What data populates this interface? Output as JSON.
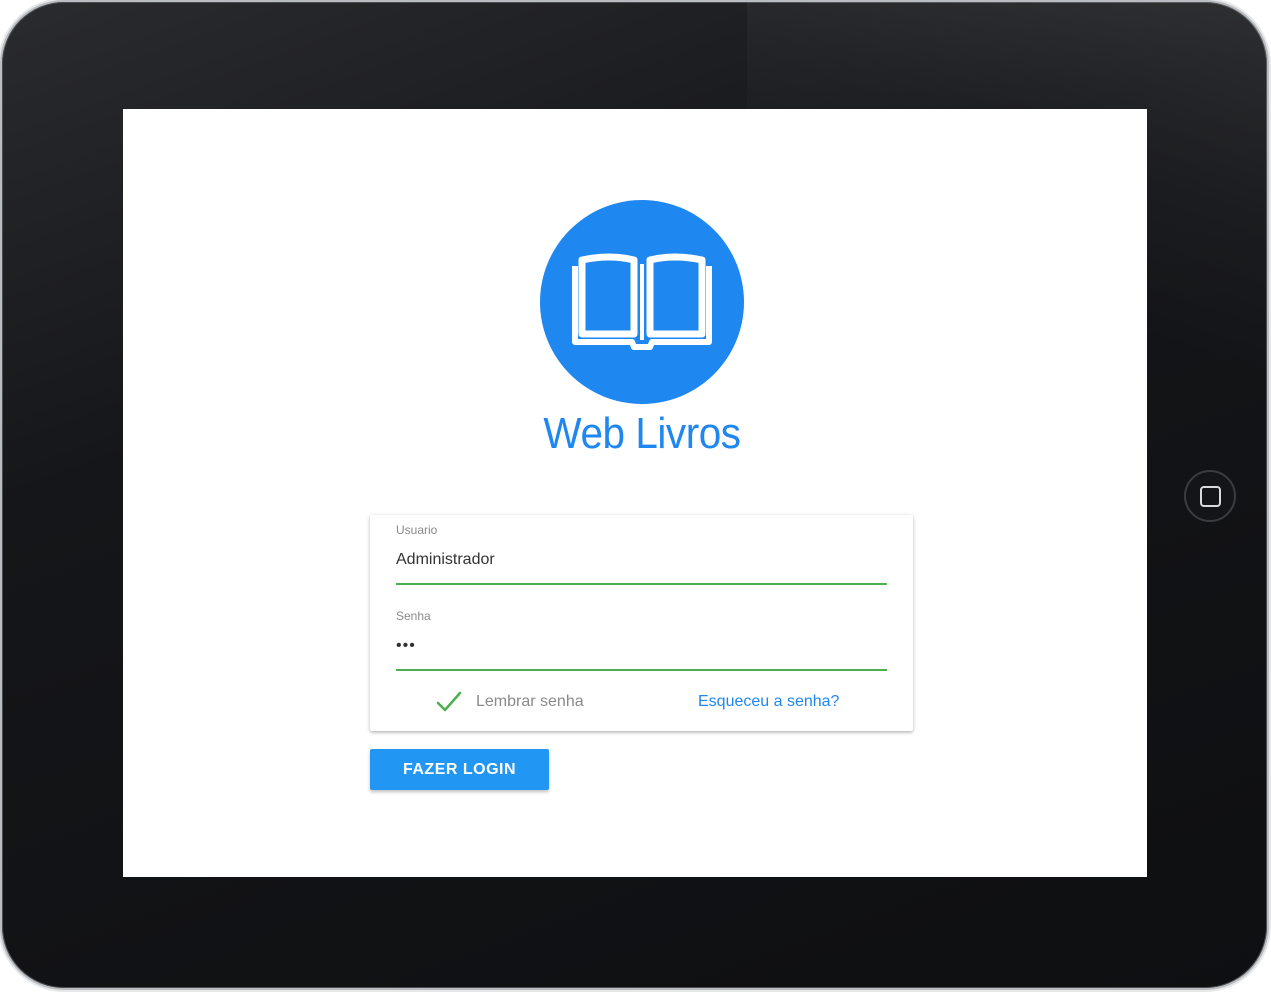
{
  "app": {
    "title": "Web Livros",
    "logo_icon": "open-book-icon"
  },
  "colors": {
    "brand": "#1f87f0",
    "button": "#2196f3",
    "input_underline": "#4caf50",
    "check": "#4caf50"
  },
  "login_form": {
    "username_label": "Usuario",
    "username_value": "Administrador",
    "password_label": "Senha",
    "password_value": "•••",
    "remember_label": "Lembrar senha",
    "remember_checked": true,
    "forgot_link": "Esqueceu a senha?",
    "submit_label": "FAZER LOGIN"
  },
  "device": {
    "home_button_icon": "home-square-icon"
  }
}
